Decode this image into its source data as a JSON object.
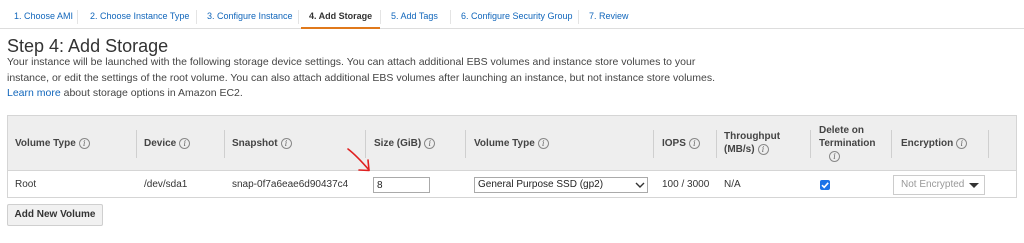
{
  "tabs": [
    {
      "label": "1. Choose AMI"
    },
    {
      "label": "2. Choose Instance Type"
    },
    {
      "label": "3. Configure Instance"
    },
    {
      "label": "4. Add Storage"
    },
    {
      "label": "5. Add Tags"
    },
    {
      "label": "6. Configure Security Group"
    },
    {
      "label": "7. Review"
    }
  ],
  "active_tab": "4. Add Storage",
  "page": {
    "title": "Step 4: Add Storage",
    "description": "Your instance will be launched with the following storage device settings. You can attach additional EBS volumes and instance store volumes to your instance, or edit the settings of the root volume. You can also attach additional EBS volumes after launching an instance, but not instance store volumes. ",
    "learn_more": "Learn more",
    "description_tail": " about storage options in Amazon EC2."
  },
  "table": {
    "headers": {
      "volume_type": "Volume Type",
      "device": "Device",
      "snapshot": "Snapshot",
      "size": "Size (GiB)",
      "ebs_type": "Volume Type",
      "iops": "IOPS",
      "throughput_1": "Throughput",
      "throughput_2": "(MB/s)",
      "delete_1": "Delete on",
      "delete_2": "Termination",
      "encryption": "Encryption"
    },
    "row": {
      "volume_type": "Root",
      "device": "/dev/sda1",
      "snapshot": "snap-0f7a6eae6d90437c4",
      "size": "8",
      "ebs_type": "General Purpose SSD (gp2)",
      "iops": "100 / 3000",
      "throughput": "N/A",
      "delete_on_termination": true,
      "encryption": "Not Encrypted"
    }
  },
  "add_button": "Add New Volume",
  "icons": {
    "info": "info-icon",
    "annotation": "red-arrow-icon",
    "checkbox": "checkbox-checked-icon"
  },
  "colors": {
    "link": "#1166bb",
    "active_tab_underline": "#e0791b",
    "checkbox": "#1a73e8",
    "annotation": "#e02020"
  }
}
